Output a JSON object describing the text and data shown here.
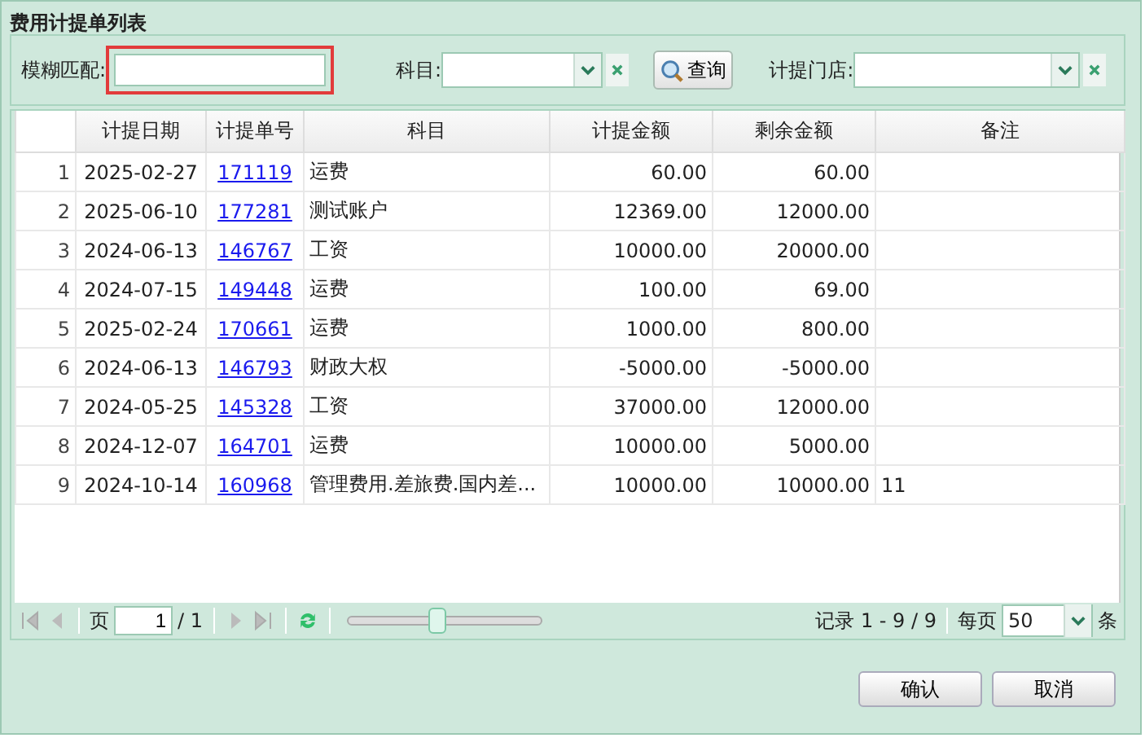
{
  "window": {
    "title": "费用计提单列表"
  },
  "filters": {
    "fuzzy": {
      "label": "模糊匹配:",
      "highlighted": true
    },
    "subject": {
      "label": "科目:"
    },
    "query_button": "查询",
    "store": {
      "label": "计提门店:"
    }
  },
  "table": {
    "columns": [
      "计提日期",
      "计提单号",
      "科目",
      "计提金额",
      "剩余金额",
      "备注"
    ],
    "rows": [
      {
        "n": "1",
        "date": "2025-02-27",
        "id": "171119",
        "subject": "运费",
        "amount": "60.00",
        "remain": "60.00",
        "note": ""
      },
      {
        "n": "2",
        "date": "2025-06-10",
        "id": "177281",
        "subject": "测试账户",
        "amount": "12369.00",
        "remain": "12000.00",
        "note": ""
      },
      {
        "n": "3",
        "date": "2024-06-13",
        "id": "146767",
        "subject": "工资",
        "amount": "10000.00",
        "remain": "20000.00",
        "note": ""
      },
      {
        "n": "4",
        "date": "2024-07-15",
        "id": "149448",
        "subject": "运费",
        "amount": "100.00",
        "remain": "69.00",
        "note": ""
      },
      {
        "n": "5",
        "date": "2025-02-24",
        "id": "170661",
        "subject": "运费",
        "amount": "1000.00",
        "remain": "800.00",
        "note": ""
      },
      {
        "n": "6",
        "date": "2024-06-13",
        "id": "146793",
        "subject": "财政大权",
        "amount": "-5000.00",
        "remain": "-5000.00",
        "note": ""
      },
      {
        "n": "7",
        "date": "2024-05-25",
        "id": "145328",
        "subject": "工资",
        "amount": "37000.00",
        "remain": "12000.00",
        "note": ""
      },
      {
        "n": "8",
        "date": "2024-12-07",
        "id": "164701",
        "subject": "运费",
        "amount": "10000.00",
        "remain": "5000.00",
        "note": ""
      },
      {
        "n": "9",
        "date": "2024-10-14",
        "id": "160968",
        "subject": "管理费用.差旅费.国内差...",
        "amount": "10000.00",
        "remain": "10000.00",
        "note": "11"
      }
    ]
  },
  "pager": {
    "page_label": "页",
    "page": "1",
    "total": "/ 1",
    "slider": {
      "level": 0.47
    },
    "records": "记录 1 - 9 / 9",
    "per_page_label": "每页",
    "per_page": "50",
    "unit": "条"
  },
  "buttons": [
    "确认",
    "取消"
  ]
}
